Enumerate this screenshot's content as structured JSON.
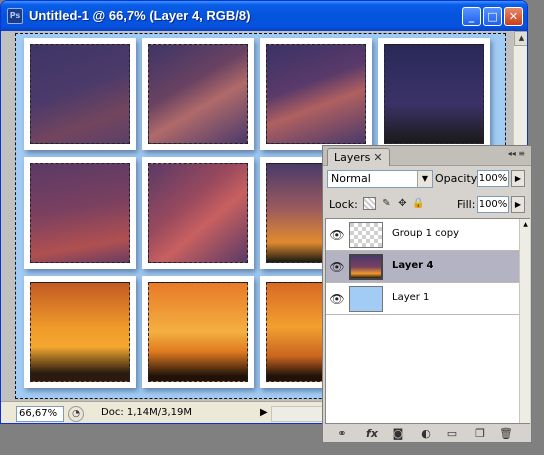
{
  "window": {
    "title": "Untitled-1 @ 66,7% (Layer 4, RGB/8)",
    "app_icon": "Ps",
    "controls": {
      "minimize": "minimize-icon",
      "maximize": "maximize-icon",
      "close": "close-icon"
    }
  },
  "status": {
    "zoom": "66,67%",
    "doc_info": "Doc: 1,14M/3,19M"
  },
  "canvas": {
    "background_color": "#a3ccf5",
    "tiles": [
      {
        "row": 1,
        "col": 1,
        "sky": "twilight"
      },
      {
        "row": 1,
        "col": 2,
        "sky": "twilight"
      },
      {
        "row": 1,
        "col": 3,
        "sky": "twilight"
      },
      {
        "row": 1,
        "col": 4,
        "sky": "twilight"
      },
      {
        "row": 2,
        "col": 1,
        "sky": "dusk"
      },
      {
        "row": 2,
        "col": 2,
        "sky": "dusk"
      },
      {
        "row": 2,
        "col": 3,
        "sky": "sunset-tree"
      },
      {
        "row": 3,
        "col": 1,
        "sky": "sunset"
      },
      {
        "row": 3,
        "col": 2,
        "sky": "sunset"
      },
      {
        "row": 3,
        "col": 3,
        "sky": "sunset"
      }
    ]
  },
  "layers_panel": {
    "tab_label": "Layers",
    "blend_mode": "Normal",
    "opacity_label": "Opacity:",
    "opacity_value": "100%",
    "lock_label": "Lock:",
    "fill_label": "Fill:",
    "fill_value": "100%",
    "layers": [
      {
        "name": "Group 1 copy",
        "visible": true,
        "selected": false
      },
      {
        "name": "Layer 4",
        "visible": true,
        "selected": true
      },
      {
        "name": "Layer 1",
        "visible": true,
        "selected": false
      }
    ],
    "footer_icons": [
      "link-icon",
      "fx-icon",
      "mask-icon",
      "adjustment-icon",
      "folder-icon",
      "new-layer-icon",
      "trash-icon"
    ],
    "footer_fx": "fx"
  }
}
